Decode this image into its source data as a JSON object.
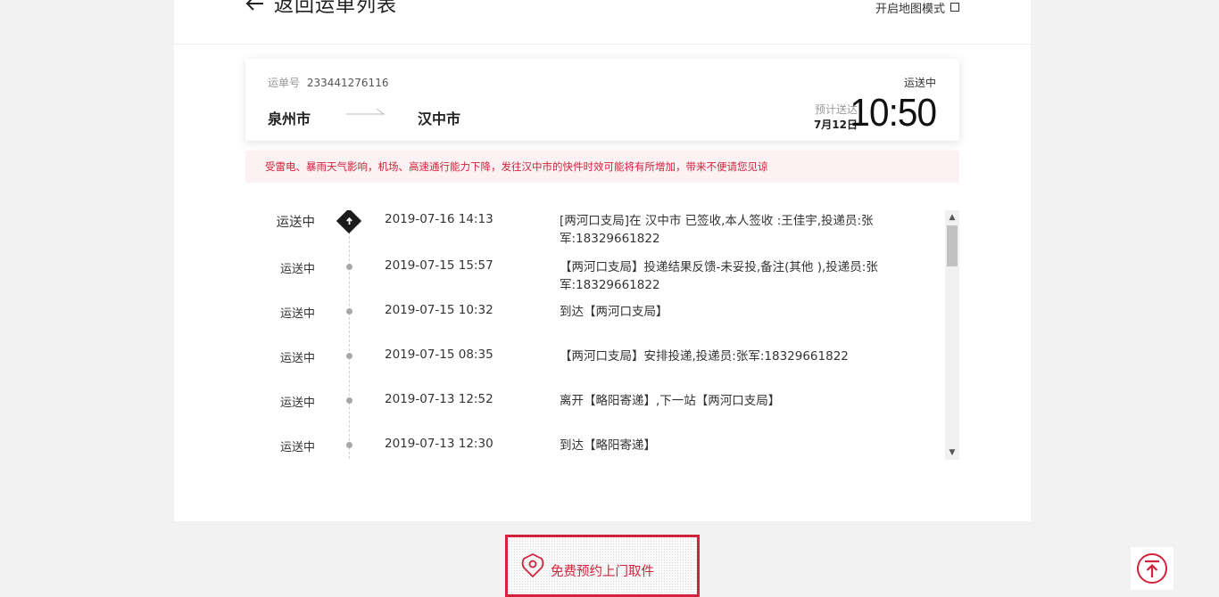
{
  "header": {
    "back_label": "返回运单列表",
    "map_mode_label": "开启地图模式"
  },
  "waybill": {
    "label": "运单号",
    "number": "233441276116",
    "status": "运送中",
    "from_city": "泉州市",
    "to_city": "汉中市",
    "eta_label": "预计送达",
    "eta_date": "7月12日",
    "eta_time": "10:50"
  },
  "notice": {
    "text": "受雷电、暴雨天气影响，机场、高速通行能力下降，发往汉中市的快件时效可能将有所增加，带来不便请您见谅"
  },
  "tracking": [
    {
      "status": "运送中",
      "time": "2019-07-16 14:13",
      "desc": "[两河口支局]在 汉中市 已签收,本人签收 :王佳宇,投递员:张军:18329661822"
    },
    {
      "status": "运送中",
      "time": "2019-07-15 15:57",
      "desc": "【两河口支局】投递结果反馈-未妥投,备注(其他 ),投递员:张军:18329661822"
    },
    {
      "status": "运送中",
      "time": "2019-07-15 10:32",
      "desc": "到达【两河口支局】"
    },
    {
      "status": "运送中",
      "time": "2019-07-15 08:35",
      "desc": "【两河口支局】安排投递,投递员:张军:18329661822"
    },
    {
      "status": "运送中",
      "time": "2019-07-13 12:52",
      "desc": "离开【略阳寄递】,下一站【两河口支局】"
    },
    {
      "status": "运送中",
      "time": "2019-07-13 12:30",
      "desc": "到达【略阳寄递】"
    }
  ],
  "pickup": {
    "label": "免费预约上门取件",
    "accent_color": "#d2233c"
  },
  "icons": {
    "back": "arrow-left-icon",
    "map_checkbox": "checkbox-icon",
    "latest": "arrow-up-diamond-icon",
    "pickup": "location-pin-icon",
    "to_top": "back-to-top-icon"
  }
}
